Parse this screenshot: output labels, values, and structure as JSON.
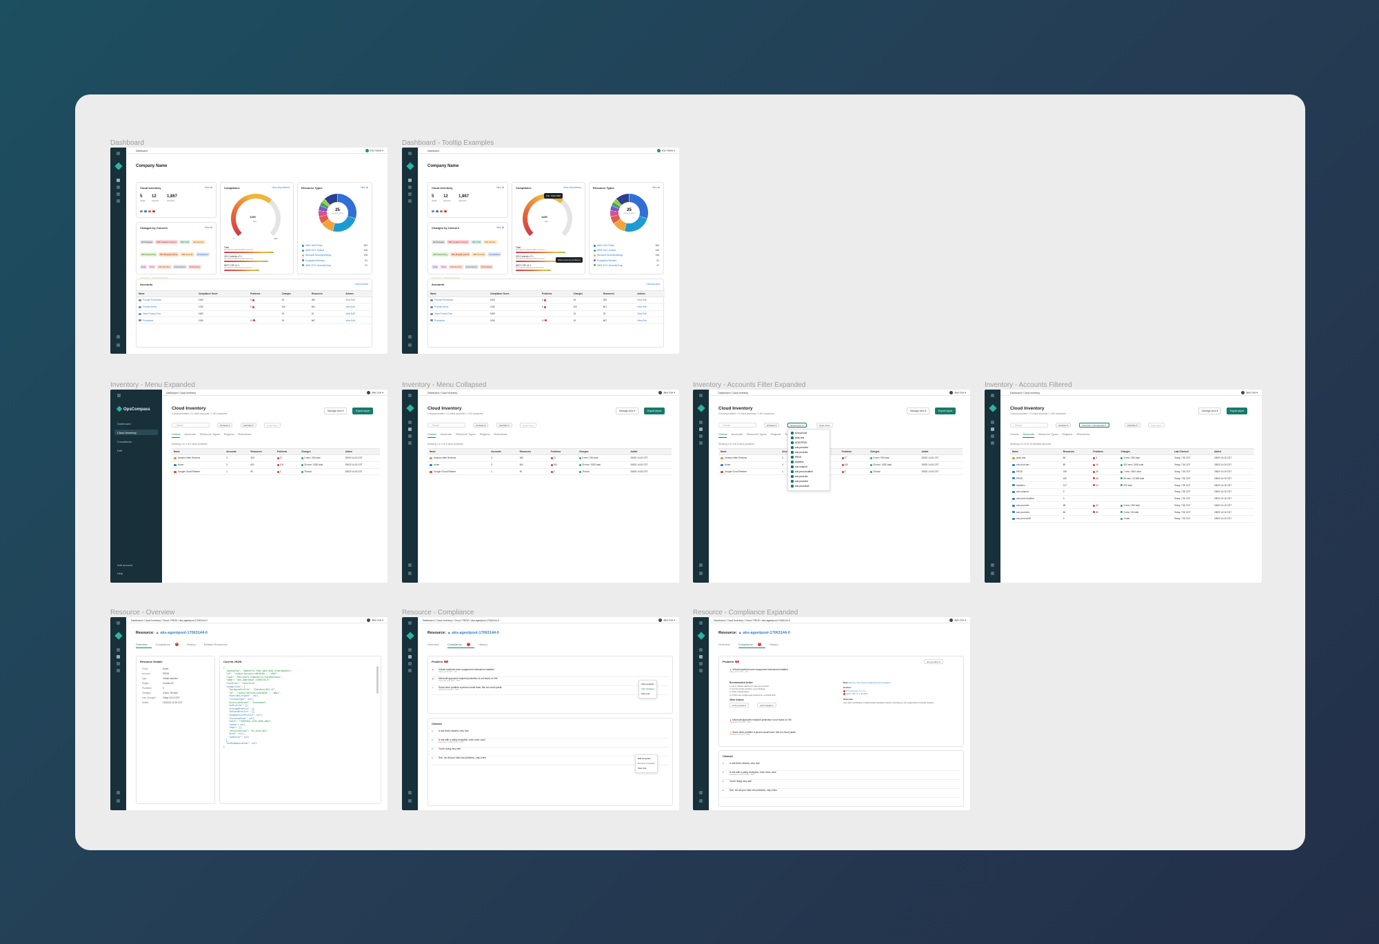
{
  "frames": {
    "dashboard": "Dashboard",
    "dashboard_tooltip": "Dashboard - Tooltip Examples",
    "inv_menu_expanded": "Inventory - Menu Expanded",
    "inv_menu_collapsed": "Inventory - Menu Collapsed",
    "inv_filter_expanded": "Inventory - Accounts Filter Expanded",
    "inv_filtered": "Inventory - Accounts Filtered",
    "res_overview": "Resource - Overview",
    "res_compliance": "Resource - Compliance",
    "res_compliance_expanded": "Resource - Compliance Expanded"
  },
  "dashboard": {
    "topbar": "Dashboard",
    "user": "Your Name",
    "company": "Company Name",
    "view_all": "View all",
    "view_all_problems": "View all problems",
    "cloud_inventory": {
      "title": "Cloud Inventory",
      "stats": [
        {
          "value": "5",
          "label": "clouds"
        },
        {
          "value": "12",
          "label": "accounts"
        },
        {
          "value": "1,867",
          "label": "resources"
        }
      ]
    },
    "compliance": {
      "title": "Compliance",
      "score": "1150",
      "score_label": "Fair",
      "range_min": "0",
      "range_max": "1800",
      "score_fraction": 0.64,
      "rows": [
        {
          "title": "Total",
          "note": "45 problems affecting 882 resources",
          "fill": 0.78
        },
        {
          "title": "CIS Controls v7.1",
          "note": "30 problems affecting 500 resources",
          "fill": 0.7
        },
        {
          "title": "NIST CSF v1.1",
          "note": "15 problems affecting 40 resources",
          "fill": 0.55
        }
      ]
    },
    "changes": {
      "title": "Changes by Concern",
      "tags": [
        {
          "label": "All Changes",
          "color": "#e6e6e6",
          "text": "#333"
        },
        {
          "label": "355 Unrated Concern",
          "color": "#fbd3d6",
          "text": "#a8222e"
        },
        {
          "label": "380 Total",
          "color": "#d9efe6",
          "text": "#1f7a5c"
        },
        {
          "label": "200 Identity",
          "color": "#fde9c9",
          "text": "#9b5b05"
        },
        {
          "label": "398 Networking",
          "color": "#dff2d6",
          "text": "#3d7a23"
        },
        {
          "label": "350 Mitigating Risk",
          "color": "#fbd7c2",
          "text": "#a4431a"
        },
        {
          "label": "398 Security",
          "color": "#fbe6c4",
          "text": "#8a5a07"
        },
        {
          "label": "Compliance",
          "color": "#dbe8fb",
          "text": "#2957a0"
        },
        {
          "label": "Cost",
          "color": "#e9dcfb",
          "text": "#5b3596"
        },
        {
          "label": "Data",
          "color": "#fbe0ec",
          "text": "#9b2a5d"
        },
        {
          "label": "IAM Security",
          "color": "#fce1d6",
          "text": "#a83b16"
        },
        {
          "label": "Governance",
          "color": "#e2e6ea",
          "text": "#3f4b56"
        },
        {
          "label": "Networking",
          "color": "#fbd9d3",
          "text": "#a13d2c"
        },
        {
          "label": "Security",
          "color": "#fbecc8",
          "text": "#8d6106"
        },
        {
          "label": "Security Defect",
          "color": "#dff2d6",
          "text": "#3d7a23"
        }
      ]
    },
    "resource_types": {
      "title": "Resource Types",
      "total": "25",
      "total_label": "resource types",
      "items": [
        {
          "name": "AWS::IAM::Policy",
          "count": "563",
          "color": "#2f6fd6"
        },
        {
          "name": "AWS::EC2::Subnet",
          "count": "449",
          "color": "#1d9bd1"
        },
        {
          "name": "Microsoft.Security/settings",
          "count": "208",
          "color": "#f1a33c"
        },
        {
          "name": "Ecosystem/Vendors",
          "count": "81",
          "color": "#7c57c8"
        },
        {
          "name": "AWS::EC2::SecurityGroup",
          "count": "67",
          "color": "#3aa56b"
        }
      ],
      "slices": [
        {
          "value": 563,
          "color": "#2f6fd6"
        },
        {
          "value": 449,
          "color": "#1d9bd1"
        },
        {
          "value": 208,
          "color": "#f1a33c"
        },
        {
          "value": 120,
          "color": "#e25a4a"
        },
        {
          "value": 95,
          "color": "#d94f95"
        },
        {
          "value": 81,
          "color": "#7c57c8"
        },
        {
          "value": 67,
          "color": "#3aa56b"
        },
        {
          "value": 60,
          "color": "#a4c639"
        },
        {
          "value": 224,
          "color": "#2b3f8f"
        }
      ]
    },
    "accounts": {
      "title": "Accounts",
      "add": "+ Add account",
      "columns": [
        "Name",
        "Compliance Score",
        "Problems",
        "Changes",
        "Resources",
        "Actions"
      ],
      "rows": [
        [
          "Product Production",
          "1520",
          "3",
          "15",
          "300"
        ],
        [
          "Product Demo",
          "1230",
          "5",
          "100",
          "601"
        ],
        [
          "Team Product Dev",
          "1600",
          "",
          "13",
          "22"
        ],
        [
          "Production",
          "1150",
          "10",
          "15",
          "667"
        ]
      ],
      "view": "View",
      "edit": "Edit"
    },
    "tooltip_score": "Fair: 1150-1500",
    "tooltip_bar": "Show score by problems"
  },
  "inventory": {
    "brand": "OpsCompass",
    "nav": [
      "Dashboard",
      "Cloud Inventory",
      "Compliance",
      "Drift"
    ],
    "nav_bottom": [
      "Add account",
      "Help"
    ],
    "breadcrumb": "Dashboard / Cloud Inventory",
    "user": "Jane Doe",
    "title": "Cloud Inventory",
    "subtitle": "3 cloud providers / 11 cloud accounts / 1,181 resources",
    "manage_view": "Manage view",
    "export": "Export report",
    "search": "Search",
    "all_dates": "All dates",
    "add_filter": "Add filter",
    "apply_filters": "Apply filters",
    "all_accounts": "All accounts",
    "accounts_selected": "Accounts = 10 selected",
    "tabs": [
      "Clouds",
      "Accounts",
      "Resource Types",
      "Regions",
      "Resources"
    ],
    "showing_clouds": "Showing 1 to 3 of 3 cloud providers",
    "showing_accounts": "Showing 1 to 10 of 10 selected accounts",
    "cloud_columns": [
      "Name",
      "Accounts",
      "Resources",
      "Problems",
      "Changes",
      "Added"
    ],
    "clouds": [
      [
        "Amazon Web Services",
        "3",
        "300",
        "27",
        "3 new / 250 total",
        "2/8/20 14:15 CST"
      ],
      [
        "Azure",
        "3",
        "601",
        "100",
        "30 new / 3032 total",
        "2/8/20 14:15 CST"
      ],
      [
        "Google Cloud Platform",
        "1",
        "90",
        "3",
        "78 total",
        "2/8/20 14:15 CST"
      ]
    ],
    "filter_options": [
      "All accounts",
      "(sub) test",
      "ACM-PROD",
      "sub-prod-test",
      "sub-prod-dev",
      "PROD",
      "Sandbox",
      "sub-nonprod",
      "sub-prod-cloudbot",
      "sub-prod-dev",
      "sub-prod-test",
      "sub-prod-test2"
    ],
    "account_columns": [
      "Name",
      "Resources",
      "Problems",
      "Changes",
      "Last Checked",
      "Added"
    ],
    "accounts": [
      [
        "(sub) test",
        "80",
        "3",
        "3 new / 250 total",
        "Today, 7:30 CDT",
        "2/8/20 14:15 CDT"
      ],
      [
        "non-prod-dev",
        "80",
        "10",
        "320 new / 2000 total",
        "Today, 7:30 CDT",
        "2/8/20 14:15 CDT"
      ],
      [
        "PROD",
        "238",
        "15",
        "7 new / 2601 total",
        "Today, 7:30 CDT",
        "2/8/20 14:15 CDT"
      ],
      [
        "PROD",
        "420",
        "16",
        "98 new / 12,960 total",
        "Today, 7:30 CDT",
        "2/8/20 14:15 CDT"
      ],
      [
        "Sandbox",
        "127",
        "24",
        "290 total",
        "Today, 7:30 CDT",
        "2/8/20 14:15 CDT"
      ],
      [
        "sub-nonprod",
        "0",
        "",
        "",
        "Today, 7:30 CDT",
        "2/8/20 14:15 CDT"
      ],
      [
        "sub-prod-cloudbot",
        "0",
        "",
        "",
        "Today, 7:30 CDT",
        "2/8/20 14:15 CDT"
      ],
      [
        "sub-prod-dev",
        "58",
        "42",
        "3 new / 250 total",
        "Today, 7:30 CDT",
        "2/8/20 14:15 CDT"
      ],
      [
        "sub-prod-test",
        "80",
        "80",
        "3 new / 25 total",
        "Today, 7:30 CDT",
        "2/8/20 14:15 CDT"
      ],
      [
        "sub-prod-web2",
        "0",
        "",
        "3 total",
        "Today, 7:30 CDT",
        "2/8/20 14:15 CDT"
      ]
    ]
  },
  "resource": {
    "breadcrumb": "Dashboard / Cloud Inventory / Cloud / PROD / aks-agentpool-17063144-0",
    "user": "Jane Doe",
    "title_prefix": "Resource:",
    "title": "aks-agentpool-17063144-0",
    "tabs": [
      "Overview",
      "Compliance",
      "History",
      "Related Resources"
    ],
    "compliance_count": "3",
    "details_title": "Resource Details",
    "details": [
      [
        "Cloud",
        "Azure"
      ],
      [
        "Account",
        "PROD"
      ],
      [
        "Type",
        "Virtual machine"
      ],
      [
        "Region",
        "Central US"
      ],
      [
        "Problems",
        "3"
      ],
      [
        "Changes",
        "3 new / 50 total"
      ],
      [
        "Last Changed",
        "Today 13:13 CDT"
      ],
      [
        "Added",
        "12/20/19 12:20 CDT"
      ]
    ],
    "json_title": "Current JSON",
    "json": [
      "  \"datasetId\": \"0d5e4f7e-f760-4de2-a9d1-d7ebfb0c82e1\",",
      "  \"id\": \"/subscriptions/ca9c8e50-...-e8d1\",",
      "  \"type\": \"Microsoft.Compute/virtualMachines\",",
      "  \"name\": \"aks-agentpool-17063144-0\",",
      "  \"location\": \"centralus\",",
      "  \"properties\": {",
      "    \"hardwareProfile\": \"Standard_DS2_v2\",",
      "    \"id\": \"/subscriptions/ca9c8e50-...-e8d1\",",
      "    \"availabilitySet\": null,",
      "    \"licenseType\": null,",
      "    \"provisionState\": \"Succeeded\",",
      "    \"osProfile\": {},",
      "    \"storageProfile\": {},",
      "    \"networkProfile\": {},",
      "    \"diagnosticsProfile\": null,",
      "    \"instanceView\": null,",
      "    \"vmId\": \"7d03f9cb-1234-4a9e-a3d1\",",
      "    \"zones\": null,",
      "    \"tags\": {},",
      "    \"resourceGroup\": \"mc_prod_aks\",",
      "    \"plan\": null,",
      "    \"identity\": null",
      "  },",
      "  \"extendedLocation\": null",
      "}"
    ],
    "problem": "Problem",
    "problem_count": "3",
    "all_severities": "All severities",
    "problems": [
      {
        "title": "Virtual machines have unapproved extensions installed",
        "meta": "Today 12:13 CDT · CIS"
      },
      {
        "title": "Microsoft approved endpoint protection is not found on VM",
        "meta": "Yesterday 9:30 CDT · NIST"
      },
      {
        "title": "Some other problem a person would have, like too much pasta",
        "meta": "10/25/19 9:30 CDT · NIST"
      }
    ],
    "actions": [
      "Add exception",
      "Add mitigation",
      "View rule"
    ],
    "cleared": "Cleared",
    "cleared_items": [
      {
        "title": "A rule that's cleared, very nice"
      },
      {
        "title": "A rule with a policy exception, even nicer, wow",
        "meta": "Exception expires 3/1/20 · NIST"
      },
      {
        "title": "You're doing very well"
      },
      {
        "title": "See, not all your rules are problems, only a few"
      }
    ],
    "row_menu": [
      "Edit exception",
      "Remove exception",
      "View rule"
    ],
    "expanded": {
      "recommended": "Recommended Action",
      "steps": [
        "1. Go to Virtual machines in the Azure portal",
        "2. For the virtual machine, go to Settings",
        "3. Click on Extensions",
        "4. If there are unapproved extensions, uninstall them"
      ],
      "other": "Other Actions",
      "buttons": [
        "Add exception",
        "Add mitigation"
      ],
      "rule_label": "Rule",
      "rule": "Ensure Only Approved Extensions Installed",
      "policies_label": "Policies",
      "policies": [
        "CIS Controls v7.1 2.2",
        "NIST CSF v1.1 ID.AM-2"
      ],
      "rationale_label": "Rationale",
      "rationale": "Use client certificates to authenticate hardware assets connecting to the organization's trusted network."
    }
  }
}
